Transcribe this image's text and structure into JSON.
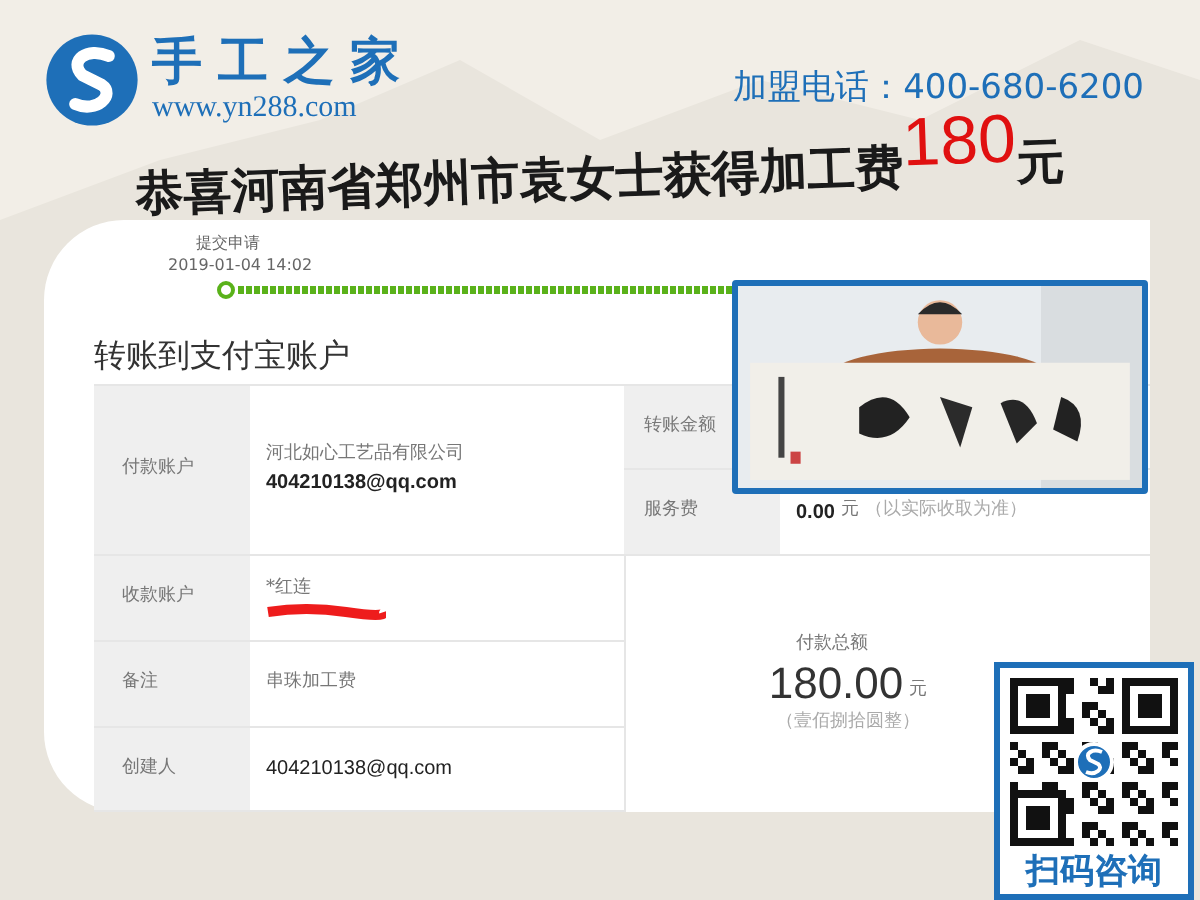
{
  "header": {
    "brand": "手工之家",
    "url": "www.yn288.com",
    "hotline": "加盟电话：400-680-6200"
  },
  "banner": {
    "text": "恭喜河南省郑州市袁女士获得加工费",
    "amount": "180",
    "unit": "元"
  },
  "progress": {
    "step": "提交申请",
    "date": "2019-01-04 14:02"
  },
  "section_title": "转账到支付宝账户",
  "payer": {
    "label": "付款账户",
    "company": "河北如心工艺品有限公司",
    "account": "404210138@qq.com"
  },
  "fees": [
    {
      "label": "转账金额"
    },
    {
      "label": "服务费",
      "amount": "0.00",
      "unit": "元",
      "note": "（以实际收取为准）"
    }
  ],
  "rows": [
    {
      "label": "收款账户",
      "value": "*红连",
      "redacted": true
    },
    {
      "label": "备注",
      "value": "串珠加工费"
    },
    {
      "label": "创建人",
      "value": "404210138@qq.com"
    }
  ],
  "total": {
    "label": "付款总额",
    "amount": "180.00",
    "unit": "元",
    "words": "（壹佰捌拾圆整）"
  },
  "qr": {
    "caption": "扫码咨询"
  }
}
